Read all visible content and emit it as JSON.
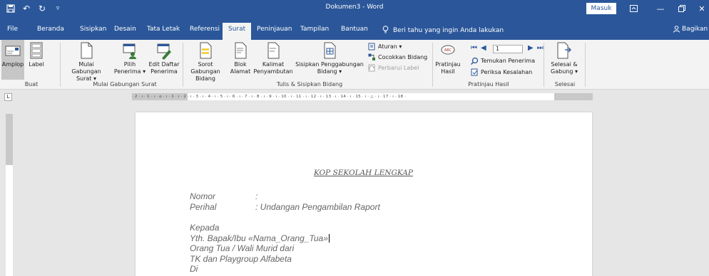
{
  "window": {
    "title": "Dokumen3  -  Word",
    "signin_label": "Masuk"
  },
  "tabs": [
    {
      "label": "File"
    },
    {
      "label": "Beranda"
    },
    {
      "label": "Sisipkan"
    },
    {
      "label": "Desain"
    },
    {
      "label": "Tata Letak"
    },
    {
      "label": "Referensi"
    },
    {
      "label": "Surat"
    },
    {
      "label": "Peninjauan"
    },
    {
      "label": "Tampilan"
    },
    {
      "label": "Bantuan"
    }
  ],
  "active_tab": "Surat",
  "tellme": {
    "label": "Beri tahu yang ingin Anda lakukan"
  },
  "share": {
    "label": "Bagikan"
  },
  "ribbon": {
    "buat": {
      "label": "Buat",
      "amplop": "Amplop",
      "label_btn": "Label"
    },
    "mulai": {
      "label": "Mulai Gabungan Surat",
      "mulai_l1": "Mulai Gabungan",
      "mulai_l2": "Surat ▾",
      "pilih_l1": "Pilih",
      "pilih_l2": "Penerima ▾",
      "edit_l1": "Edit Daftar",
      "edit_l2": "Penerima"
    },
    "tulis": {
      "label": "Tulis & Sisipkan Bidang",
      "sorot_l1": "Sorot Gabungan",
      "sorot_l2": "Bidang",
      "blok_l1": "Blok",
      "blok_l2": "Alamat",
      "kalimat_l1": "Kalimat",
      "kalimat_l2": "Penyambutan",
      "sisipkan_l1": "Sisipkan Penggabungan",
      "sisipkan_l2": "Bidang ▾",
      "aturan": "Aturan ▾",
      "cocokkan": "Cocokkan Bidang",
      "perbarui": "Perbarui Label"
    },
    "pratinjau": {
      "label": "Pratinjau Hasil",
      "btn_l1": "Pratinjau",
      "btn_l2": "Hasil",
      "record": "1",
      "temukan": "Temukan Penerima",
      "periksa": "Periksa Kesalahan"
    },
    "selesai": {
      "label": "Selesai",
      "btn_l1": "Selesai &",
      "btn_l2": "Gabung ▾"
    }
  },
  "ruler": {
    "corner": "L",
    "ticks": "· 2 · ı · 1 · ı · ⌂ · ı · 1 · ı · 2 · ı · 3 · ı · 4 · ı · 5 · ı · 6 · ı · 7 · ı · 8 · ı · 9 · ı · 10 · ı · 11 · ı · 12 · ı · 13 · ı · 14 · ı · 15 · ı · △ · ı · 17 · ı · 18 ·"
  },
  "document": {
    "title": "KOP SEKOLAH LENGKAP",
    "nomor_label": "Nomor",
    "nomor_value": ":",
    "perihal_label": "Perihal",
    "perihal_value": ": Undangan Pengambilan Raport",
    "kepada": "Kepada",
    "yth": "Yth. Bapak/Ibu «Nama_Orang_Tua»",
    "line_ortu": "Orang Tua / Wali Murid dari",
    "line_school": "TK dan Playgroup Alfabeta",
    "line_di": "Di"
  },
  "colors": {
    "accent": "#2b579a",
    "ribbon_bg": "#f3f3f3",
    "canvas_bg": "#e6e6e6"
  }
}
